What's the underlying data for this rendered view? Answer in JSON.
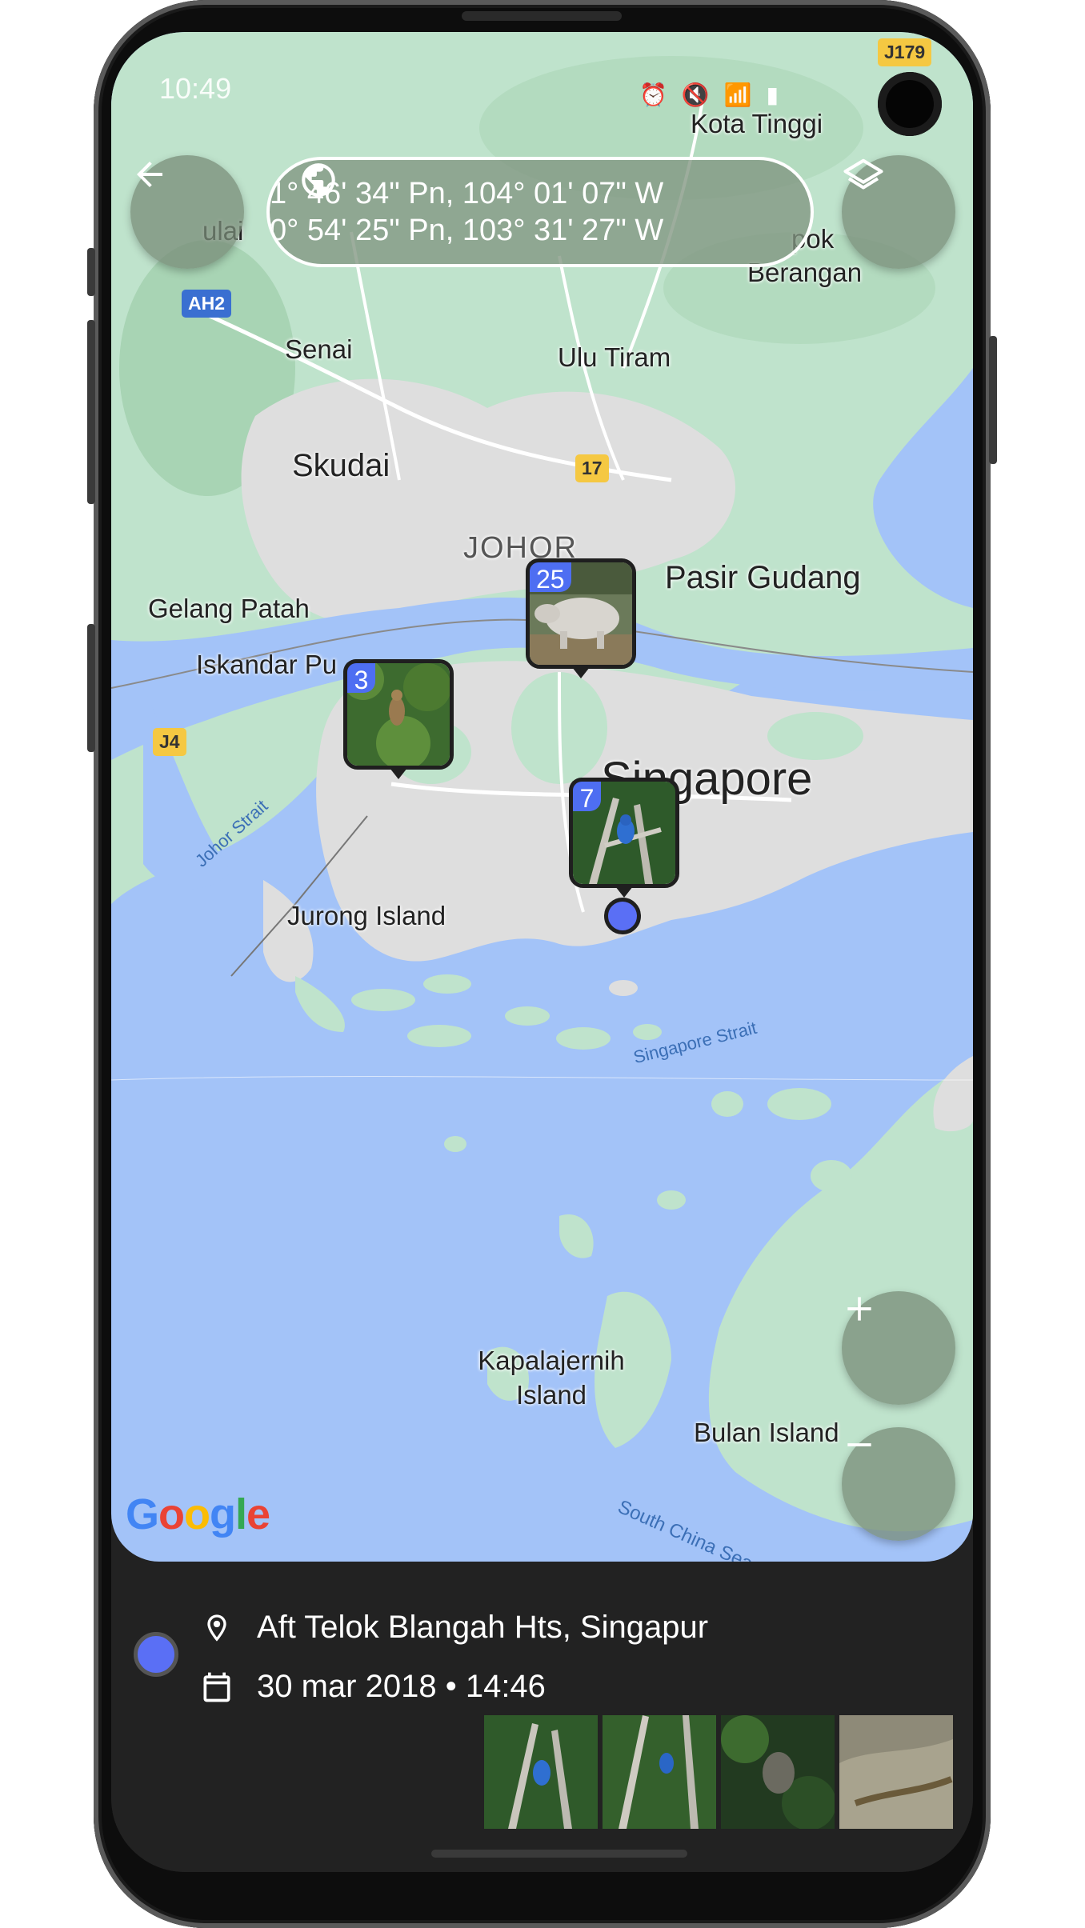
{
  "status_bar": {
    "time": "10:49"
  },
  "header": {
    "back_icon": "arrow-left-icon",
    "layers_icon": "layers-icon",
    "coords": {
      "icon": "globe-icon",
      "line1": "1° 46' 34\" Pn, 104° 01' 07\" W",
      "line2": "0° 54' 25\" Pn, 103° 31' 27\" W"
    }
  },
  "map": {
    "labels": {
      "kota_tinggi": "Kota Tinggi",
      "kulai": "ulai",
      "kopok": "pok",
      "berangan": "Berangan",
      "senai": "Senai",
      "ulu_tiram": "Ulu Tiram",
      "skudai": "Skudai",
      "johor": "JOHOR",
      "pasir_gudang": "Pasir Gudang",
      "gelang_patah": "Gelang Patah",
      "iskandar_puteri": "Iskandar Pu",
      "singapore": "Singapore",
      "jurong_island": "Jurong Island",
      "johor_strait": "Johor Strait",
      "singapore_strait": "Singapore Strait",
      "kapalajernih": "Kapalajernih",
      "kapalajernih_island": "Island",
      "bulan_island": "Bulan Island",
      "south_china_sea": "South China Sea",
      "shield_ah2": "AH2",
      "shield_17": "17",
      "shield_j4": "J4",
      "shield_j179": "J179"
    },
    "clusters": [
      {
        "count": "25",
        "subject": "rhinoceros"
      },
      {
        "count": "3",
        "subject": "bird-in-foliage"
      },
      {
        "count": "7",
        "subject": "blue-kingfisher"
      }
    ],
    "attribution": "Google",
    "zoom_in_icon": "plus-icon",
    "zoom_out_icon": "minus-icon"
  },
  "details": {
    "location_icon": "location-pin-icon",
    "location": "Aft Telok Blangah Hts, Singapur",
    "date_icon": "calendar-icon",
    "datetime": "30 mar 2018 • 14:46"
  },
  "colors": {
    "accent": "#4e6ef2",
    "water": "#a3c3f8",
    "land": "#bfe3cc",
    "urban": "#dedede",
    "panel": "#222222"
  }
}
